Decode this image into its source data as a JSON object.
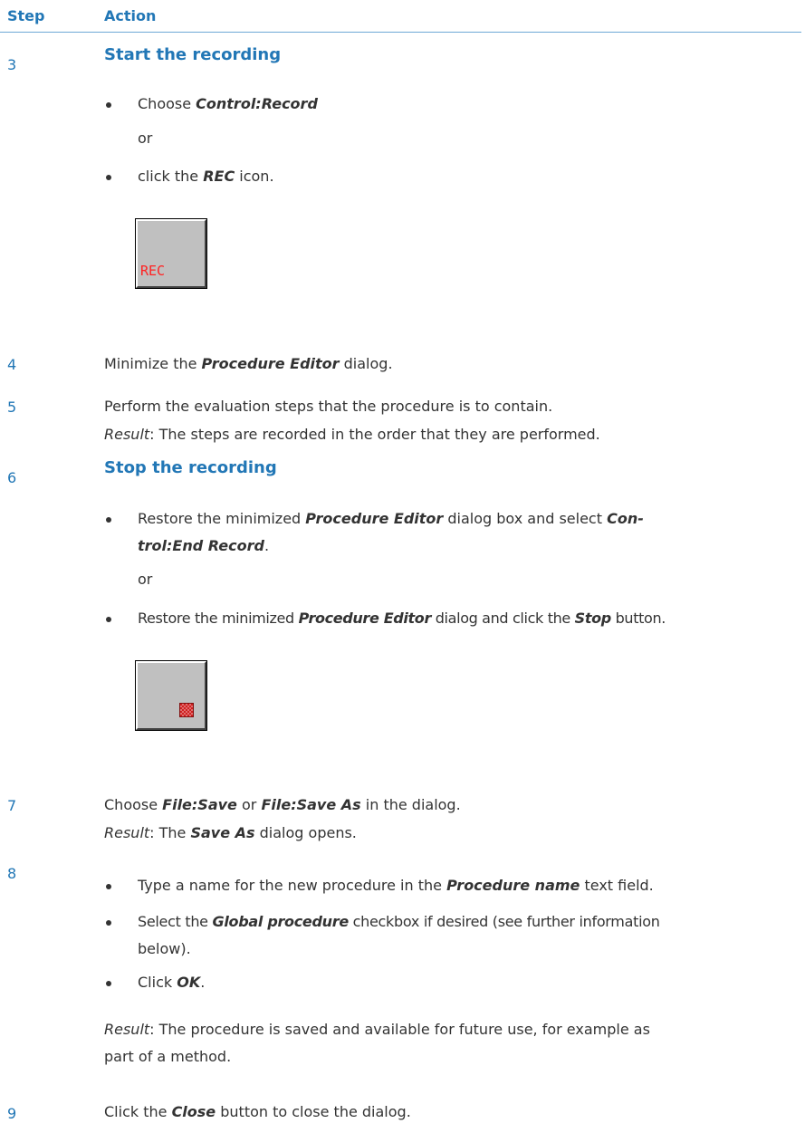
{
  "header": {
    "step": "Step",
    "action": "Action"
  },
  "steps": {
    "s3": {
      "number": "3",
      "title": "Start the recording",
      "b1_pre": "Choose ",
      "b1_em": "Control:Record",
      "or": "or",
      "b2_pre": "click the ",
      "b2_em": "REC",
      "b2_post": " icon.",
      "icon_label": "REC"
    },
    "s4": {
      "number": "4",
      "pre": "Minimize the ",
      "em": "Procedure Editor",
      "post": " dialog."
    },
    "s5": {
      "number": "5",
      "text": "Perform the evaluation steps that the procedure is to contain.",
      "result_label": "Result",
      "result_text": ": The steps are recorded in the order that they are performed."
    },
    "s6": {
      "number": "6",
      "title": "Stop the recording",
      "b1_pre": "Restore the minimized ",
      "b1_em": "Procedure Editor",
      "b1_mid": " dialog box and select ",
      "b1_em2a": "Con-",
      "b1_em2b": "trol:End Record",
      "b1_post": ".",
      "or": "or",
      "b2_pre": "Restore the minimized ",
      "b2_em": "Procedure Editor",
      "b2_mid": " dialog and click the ",
      "b2_em2": "Stop",
      "b2_post": " button."
    },
    "s7": {
      "number": "7",
      "pre": "Choose ",
      "em1": "File:Save",
      "mid": " or ",
      "em2": "File:Save As",
      "post": " in the dialog.",
      "result_label": "Result",
      "result_pre": ": The ",
      "result_em": "Save As",
      "result_post": " dialog opens."
    },
    "s8": {
      "number": "8",
      "b1_pre": "Type a name for the new procedure in the ",
      "b1_em": "Procedure name",
      "b1_post": " text field.",
      "b2_pre": "Select the ",
      "b2_em": "Global procedure",
      "b2_post": " checkbox if desired (see further information",
      "b2_line2": "below).",
      "b3_pre": "Click ",
      "b3_em": "OK",
      "b3_post": ".",
      "result_label": "Result",
      "result_text": ": The procedure is saved and available for future use, for example as",
      "result_line2": "part of a method."
    },
    "s9": {
      "number": "9",
      "pre": "Click the ",
      "em": "Close",
      "post": " button to close the dialog."
    }
  }
}
